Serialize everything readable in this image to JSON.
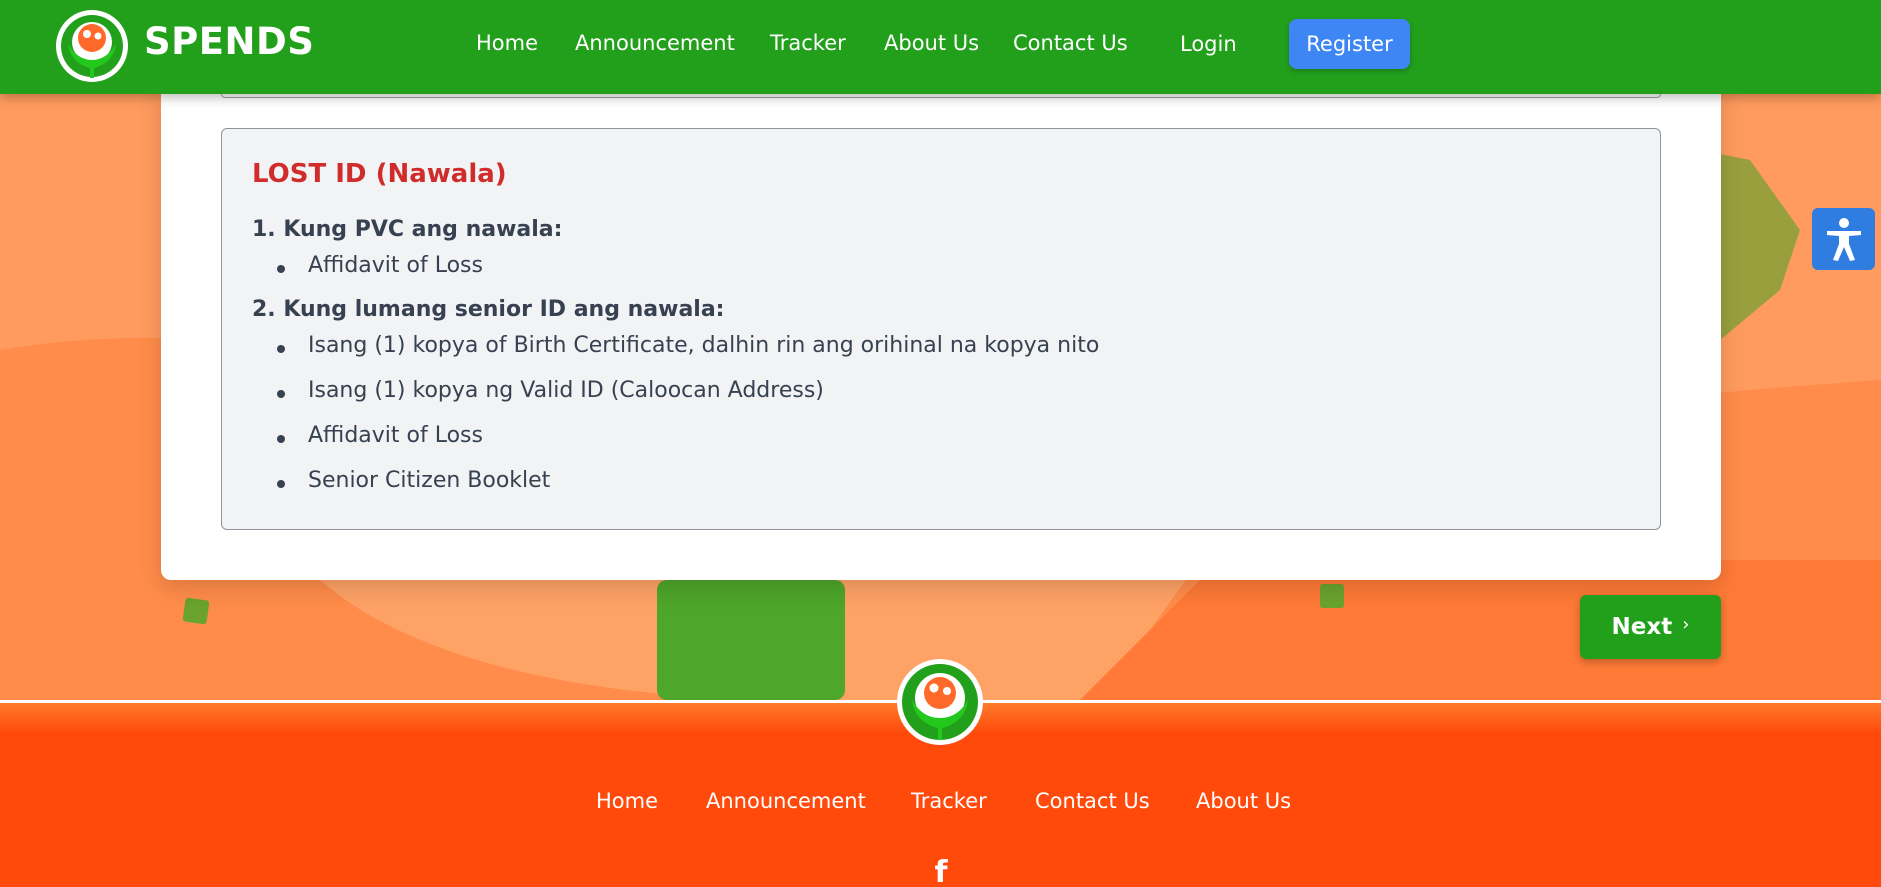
{
  "header": {
    "brand_name": "SPENDS",
    "nav": [
      "Home",
      "Announcement",
      "Tracker",
      "About Us",
      "Contact Us"
    ],
    "login_label": "Login",
    "register_label": "Register"
  },
  "requirements": {
    "title": "LOST ID (Nawala)",
    "sections": [
      {
        "heading": "1. Kung PVC ang nawala:",
        "items": [
          "Affidavit of Loss"
        ]
      },
      {
        "heading": "2. Kung lumang senior ID ang nawala:",
        "items": [
          "Isang (1) kopya of Birth Certificate, dalhin rin ang orihinal na kopya nito",
          "Isang (1) kopya ng Valid ID (Caloocan Address)",
          "Affidavit of Loss",
          "Senior Citizen Booklet"
        ]
      }
    ]
  },
  "next_label": "Next",
  "next_icon": "chevron-right-icon",
  "accessibility_icon": "accessibility-person-icon",
  "footer": {
    "nav": [
      "Home",
      "Announcement",
      "Tracker",
      "Contact Us",
      "About Us"
    ],
    "social_icon": "facebook-icon"
  },
  "colors": {
    "primary_green": "#22a01c",
    "footer_orange": "#ff4a0c",
    "title_red": "#d12c2c",
    "register_blue": "#3f86f5"
  }
}
